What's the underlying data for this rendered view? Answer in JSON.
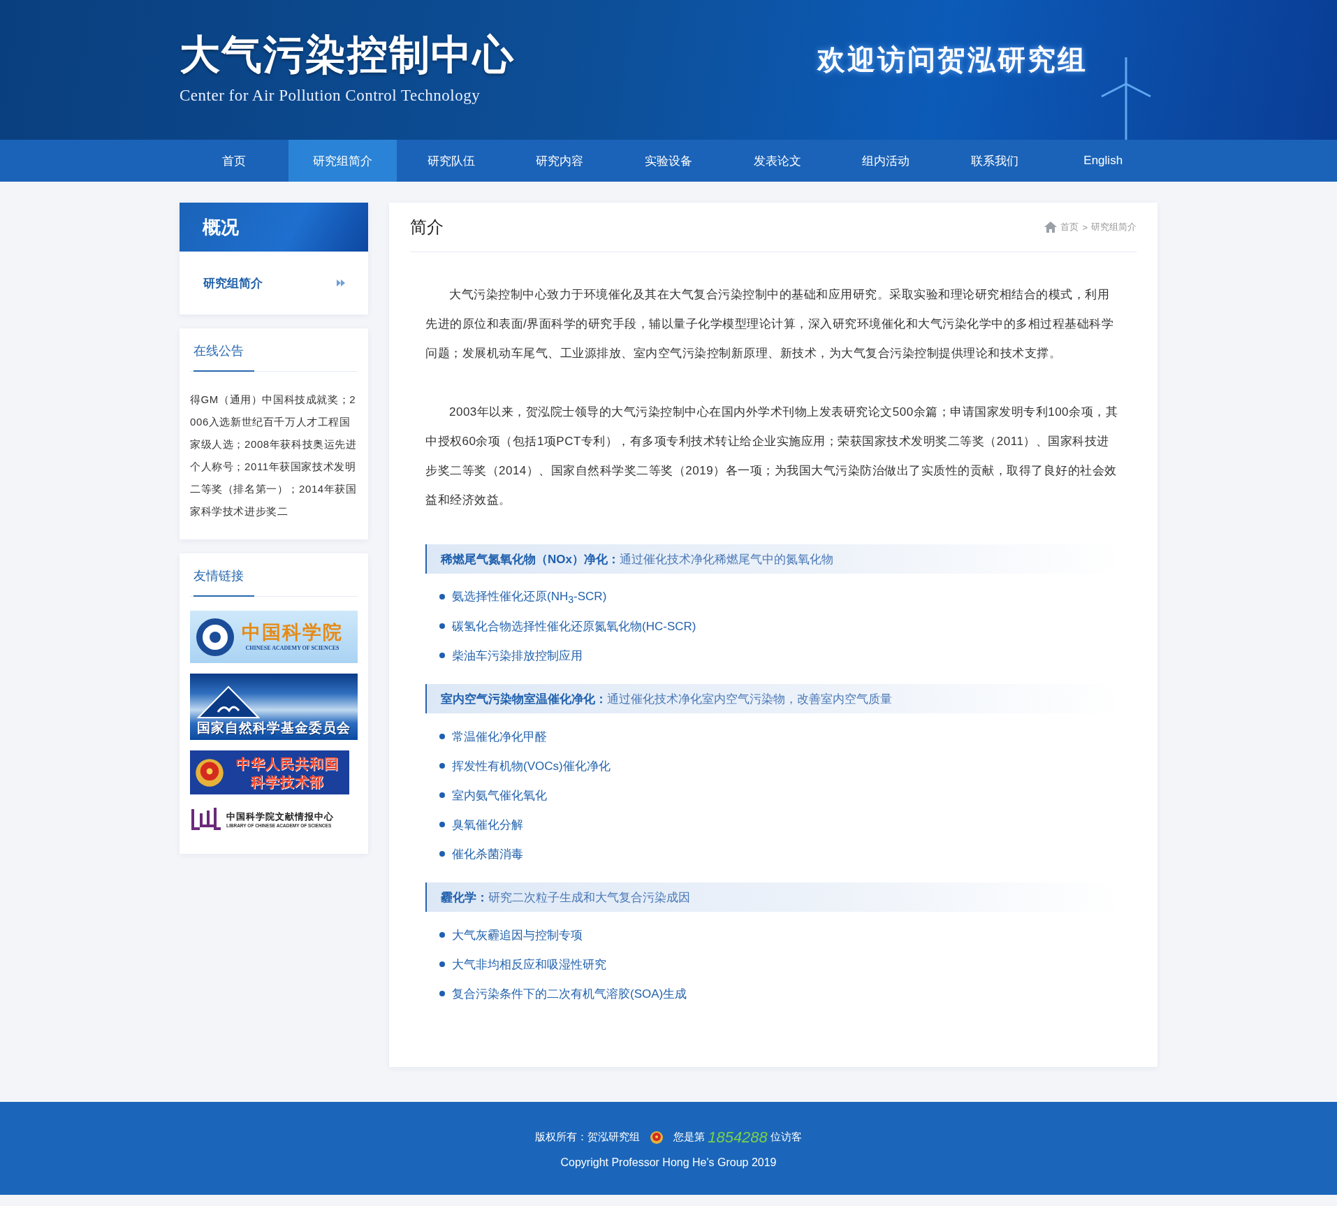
{
  "header": {
    "title": "大气污染控制中心",
    "subtitle": "Center for Air Pollution Control Technology",
    "welcome": "欢迎访问贺泓研究组"
  },
  "nav": [
    {
      "label": "首页",
      "selected": false
    },
    {
      "label": "研究组简介",
      "selected": true
    },
    {
      "label": "研究队伍",
      "selected": false
    },
    {
      "label": "研究内容",
      "selected": false
    },
    {
      "label": "实验设备",
      "selected": false
    },
    {
      "label": "发表论文",
      "selected": false
    },
    {
      "label": "组内活动",
      "selected": false
    },
    {
      "label": "联系我们",
      "selected": false
    },
    {
      "label": "English",
      "selected": false
    }
  ],
  "sidebar": {
    "section_title": "概况",
    "menu": [
      {
        "label": "研究组简介",
        "selected": true
      }
    ],
    "notice": {
      "title": "在线公告",
      "text": "得GM（通用）中国科技成就奖；2006入选新世纪百千万人才工程国家级人选；2008年获科技奥运先进个人称号；2011年获国家技术发明二等奖（排名第一）；2014年获国家科学技术进步奖二"
    },
    "links": {
      "title": "友情链接",
      "items": [
        {
          "kind": "cas",
          "title": "中国科学院",
          "subtitle": "CHINESE ACADEMY OF SCIENCES"
        },
        {
          "kind": "nsfc",
          "title": "国家自然科学基金委员会"
        },
        {
          "kind": "most",
          "title": "中华人民共和国",
          "subtitle": "科学技术部"
        },
        {
          "kind": "library",
          "title": "中国科学院文献情报中心",
          "subtitle": "LIBRARY OF CHINESE ACADEMY OF SCIENCES"
        }
      ]
    }
  },
  "content": {
    "title": "简介",
    "breadcrumb": {
      "items": [
        "首页",
        "研究组简介"
      ],
      "separator": ">"
    },
    "paragraphs": [
      "大气污染控制中心致力于环境催化及其在大气复合污染控制中的基础和应用研究。采取实验和理论研究相结合的模式，利用先进的原位和表面/界面科学的研究手段，辅以量子化学模型理论计算，深入研究环境催化和大气污染化学中的多相过程基础科学问题；发展机动车尾气、工业源排放、室内空气污染控制新原理、新技术，为大气复合污染控制提供理论和技术支撑。",
      "2003年以来，贺泓院士领导的大气污染控制中心在国内外学术刊物上发表研究论文500余篇；申请国家发明专利100余项，其中授权60余项（包括1项PCT专利），有多项专利技术转让给企业实施应用；荣获国家技术发明奖二等奖（2011）、国家科技进步奖二等奖（2014）、国家自然科学奖二等奖（2019）各一项；为我国大气污染防治做出了实质性的贡献，取得了良好的社会效益和经济效益。"
    ],
    "topics": [
      {
        "heading": "稀燃尾气氮氧化物（NOx）净化：",
        "description": "通过催化技术净化稀燃尾气中的氮氧化物",
        "items": [
          "氨选择性催化还原(NH$_{3}$-SCR)",
          "碳氢化合物选择性催化还原氮氧化物(HC-SCR)",
          "柴油车污染排放控制应用"
        ]
      },
      {
        "heading": "室内空气污染物室温催化净化：",
        "description": "通过催化技术净化室内空气污染物，改善室内空气质量",
        "items": [
          "常温催化净化甲醛",
          "挥发性有机物(VOCs)催化净化",
          "室内氨气催化氧化",
          "臭氧催化分解",
          "催化杀菌消毒"
        ]
      },
      {
        "heading": "霾化学：",
        "description": "研究二次粒子生成和大气复合污染成因",
        "items": [
          "大气灰霾追因与控制专项",
          "大气非均相反应和吸湿性研究",
          "复合污染条件下的二次有机气溶胶(SOA)生成"
        ]
      }
    ]
  },
  "footer": {
    "copyright_owner": "版权所有：贺泓研究组",
    "visitor_prefix": "您是第",
    "visitor_count": "1854288",
    "visitor_suffix": "位访客",
    "copyright": "Copyright Professor Hong He's Group 2019"
  }
}
